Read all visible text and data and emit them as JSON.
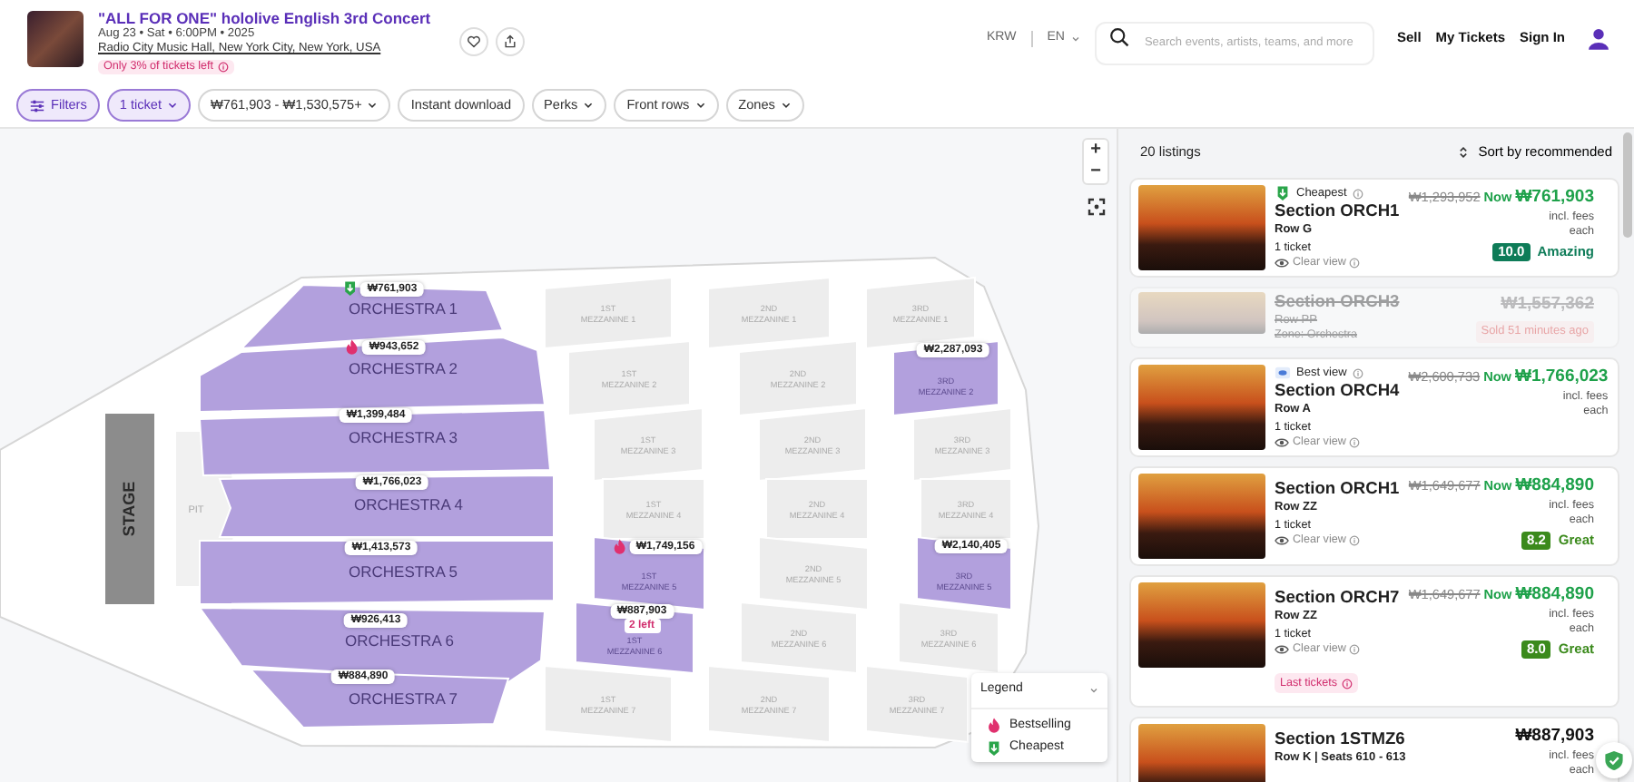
{
  "event": {
    "title": "\"ALL FOR ONE\" hololive English 3rd Concert",
    "date": "Aug 23 • Sat • 6:00PM • 2025",
    "venue": "Radio City Music Hall, New York City, New York, USA",
    "scarcity": "Only 3% of tickets left"
  },
  "nav": {
    "currency": "KRW",
    "language": "EN",
    "search": {
      "placeholder": "Search events, artists, teams, and more"
    },
    "links": [
      "Sell",
      "My Tickets",
      "Sign In"
    ]
  },
  "filters": [
    {
      "label": "Filters",
      "selected": true,
      "kind": "filters"
    },
    {
      "label": "1 ticket",
      "selected": true,
      "kind": "dropdown"
    },
    {
      "label": "₩761,903 - ₩1,530,575+",
      "selected": false,
      "kind": "dropdown"
    },
    {
      "label": "Instant download",
      "selected": false,
      "kind": "toggle"
    },
    {
      "label": "Perks",
      "selected": false,
      "kind": "dropdown"
    },
    {
      "label": "Front rows",
      "selected": false,
      "kind": "dropdown"
    },
    {
      "label": "Zones",
      "selected": false,
      "kind": "dropdown"
    }
  ],
  "map": {
    "stage": "STAGE",
    "pit": "PIT",
    "controls": [
      "+",
      "−"
    ],
    "sections": [
      {
        "label": "ORCHESTRA 1",
        "available": true,
        "price": "₩761,903",
        "kind": "cheapest"
      },
      {
        "label": "ORCHESTRA 2",
        "available": true,
        "price": "₩943,652",
        "kind": "bestselling"
      },
      {
        "label": "ORCHESTRA 3",
        "available": true,
        "price": "₩1,399,484"
      },
      {
        "label": "ORCHESTRA 4",
        "available": true,
        "price": "₩1,766,023"
      },
      {
        "label": "ORCHESTRA 5",
        "available": true,
        "price": "₩1,413,573"
      },
      {
        "label": "ORCHESTRA 6",
        "available": true,
        "price": "₩926,413"
      },
      {
        "label": "ORCHESTRA 7",
        "available": true,
        "price": "₩884,890"
      },
      {
        "tier": "1ST",
        "label": "MEZZANINE 1",
        "available": false
      },
      {
        "tier": "1ST",
        "label": "MEZZANINE 2",
        "available": false
      },
      {
        "tier": "1ST",
        "label": "MEZZANINE 3",
        "available": false
      },
      {
        "tier": "1ST",
        "label": "MEZZANINE 4",
        "available": false
      },
      {
        "tier": "1ST",
        "label": "MEZZANINE 5",
        "available": true,
        "price": "₩1,749,156",
        "kind": "bestselling"
      },
      {
        "tier": "1ST",
        "label": "MEZZANINE 6",
        "available": true,
        "price": "₩887,903",
        "note": "2 left"
      },
      {
        "tier": "1ST",
        "label": "MEZZANINE 7",
        "available": false
      },
      {
        "tier": "2ND",
        "label": "MEZZANINE 1",
        "available": false
      },
      {
        "tier": "2ND",
        "label": "MEZZANINE 2",
        "available": false
      },
      {
        "tier": "2ND",
        "label": "MEZZANINE 3",
        "available": false
      },
      {
        "tier": "2ND",
        "label": "MEZZANINE 4",
        "available": false
      },
      {
        "tier": "2ND",
        "label": "MEZZANINE 5",
        "available": false
      },
      {
        "tier": "2ND",
        "label": "MEZZANINE 6",
        "available": false
      },
      {
        "tier": "2ND",
        "label": "MEZZANINE 7",
        "available": false
      },
      {
        "tier": "3RD",
        "label": "MEZZANINE 1",
        "available": false
      },
      {
        "tier": "3RD",
        "label": "MEZZANINE 2",
        "available": true,
        "price": "₩2,287,093"
      },
      {
        "tier": "3RD",
        "label": "MEZZANINE 3",
        "available": false
      },
      {
        "tier": "3RD",
        "label": "MEZZANINE 4",
        "available": false
      },
      {
        "tier": "3RD",
        "label": "MEZZANINE 5",
        "available": true,
        "price": "₩2,140,405"
      },
      {
        "tier": "3RD",
        "label": "MEZZANINE 6",
        "available": false
      },
      {
        "tier": "3RD",
        "label": "MEZZANINE 7",
        "available": false
      }
    ],
    "legend": {
      "title": "Legend",
      "items": [
        {
          "kind": "bestselling",
          "label": "Bestselling"
        },
        {
          "kind": "cheapest",
          "label": "Cheapest"
        }
      ]
    }
  },
  "listings": {
    "count": "20 listings",
    "sort": "Sort by recommended",
    "items": [
      {
        "kind": "available",
        "tag": {
          "kind": "cheapest",
          "text": "Cheapest"
        },
        "section": "Section ORCH1",
        "row": "Row G",
        "tickets": "1 ticket",
        "view": "Clear view",
        "old_price": "₩1,293,952",
        "now": "Now",
        "price": "₩761,903",
        "fees": "incl. fees",
        "each": "each",
        "rating": {
          "score": "10.0",
          "text": "Amazing",
          "color": "#0e7c58"
        }
      },
      {
        "kind": "sold",
        "section": "Section ORCH3",
        "row": "Row PP",
        "zone": "Zone: Orchestra",
        "price": "₩1,557,362",
        "status": "Sold 51 minutes ago"
      },
      {
        "kind": "available",
        "tag": {
          "kind": "bestview",
          "text": "Best view"
        },
        "section": "Section ORCH4",
        "row": "Row A",
        "tickets": "1 ticket",
        "view": "Clear view",
        "old_price": "₩2,600,733",
        "now": "Now",
        "price": "₩1,766,023",
        "fees": "incl. fees",
        "each": "each"
      },
      {
        "kind": "available",
        "section": "Section ORCH1",
        "row": "Row ZZ",
        "tickets": "1 ticket",
        "view": "Clear view",
        "old_price": "₩1,649,677",
        "now": "Now",
        "price": "₩884,890",
        "fees": "incl. fees",
        "each": "each",
        "rating": {
          "score": "8.2",
          "text": "Great",
          "color": "#3b8a1c"
        }
      },
      {
        "kind": "available",
        "section": "Section ORCH7",
        "row": "Row ZZ",
        "tickets": "1 ticket",
        "view": "Clear view",
        "old_price": "₩1,649,677",
        "now": "Now",
        "price": "₩884,890",
        "fees": "incl. fees",
        "each": "each",
        "rating": {
          "score": "8.0",
          "text": "Great",
          "color": "#3b8a1c"
        },
        "badge": "Last tickets"
      },
      {
        "kind": "available",
        "section": "Section 1STMZ6",
        "row": "Row K | Seats 610 - 613",
        "price": "₩887,903",
        "fees": "incl. fees",
        "each": "each"
      }
    ]
  }
}
